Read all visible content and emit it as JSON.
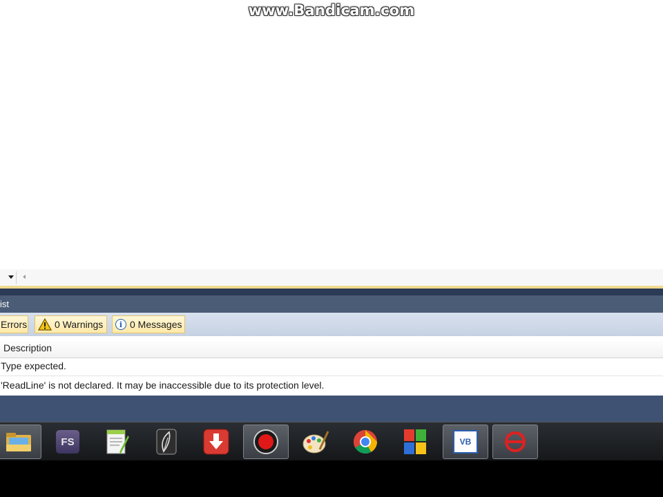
{
  "watermark": "www.Bandicam.com",
  "error_list": {
    "title": "ist",
    "toolbar": {
      "errors_label": "Errors",
      "warnings_label": "0 Warnings",
      "messages_label": "0 Messages"
    },
    "columns": {
      "description": "Description"
    },
    "rows": [
      {
        "description": "Type expected."
      },
      {
        "description": "'ReadLine' is not declared. It may be inaccessible due to its protection level."
      }
    ]
  },
  "taskbar": {
    "fs_label": "FS",
    "vb_label": "VB",
    "icons": [
      "explorer-folder-icon",
      "fs-app-icon",
      "notepad-plus-plus-icon",
      "feather-app-icon",
      "download-manager-icon",
      "bandicam-record-icon",
      "paint-palette-icon",
      "chrome-icon",
      "windows-flag-icon",
      "visual-basic-icon",
      "garena-icon"
    ]
  },
  "colors": {
    "panel_header": "#4b5c77",
    "toolbar": "#c9d5e6",
    "button_fill": "#ffeeb8",
    "taskbar": "#1e2125"
  }
}
